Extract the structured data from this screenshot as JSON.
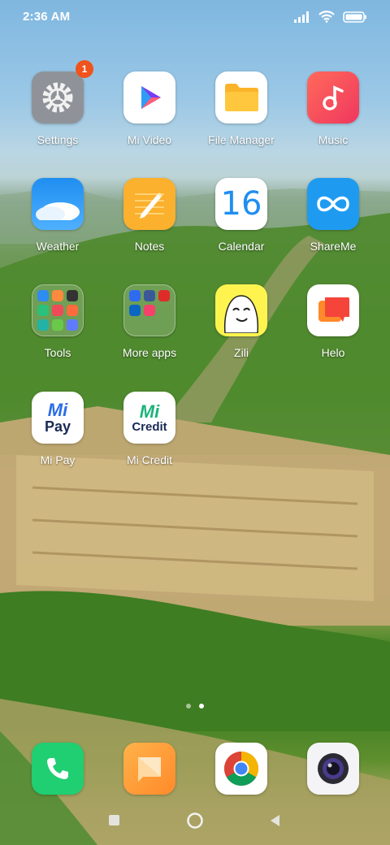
{
  "status_bar": {
    "time": "2:36 AM",
    "icons": [
      "signal-icon",
      "wifi-icon",
      "battery-icon"
    ]
  },
  "apps": {
    "settings": {
      "label": "Settings",
      "badge": "1"
    },
    "mi_video": {
      "label": "Mi Video"
    },
    "file_manager": {
      "label": "File Manager"
    },
    "music": {
      "label": "Music"
    },
    "weather": {
      "label": "Weather"
    },
    "notes": {
      "label": "Notes"
    },
    "calendar": {
      "label": "Calendar",
      "day": "16"
    },
    "shareme": {
      "label": "ShareMe"
    },
    "tools": {
      "label": "Tools"
    },
    "more_apps": {
      "label": "More apps"
    },
    "zili": {
      "label": "Zili"
    },
    "helo": {
      "label": "Helo"
    },
    "mi_pay": {
      "label": "Mi Pay",
      "logo_top": "Mi",
      "logo_bottom": "Pay"
    },
    "mi_credit": {
      "label": "Mi Credit",
      "logo_top": "Mi",
      "logo_bottom": "Credit"
    }
  },
  "dock": [
    "phone-icon",
    "messaging-icon",
    "chrome-icon",
    "camera-icon"
  ],
  "page_indicator": {
    "count": 2,
    "active": 2
  },
  "nav_bar": [
    "recents-icon",
    "home-icon",
    "back-icon"
  ],
  "colors": {
    "badge": "#f0531c",
    "accent_blue": "#1f8ef0",
    "file_manager_yellow": "#fbb42a",
    "music_red": "#f04a5a"
  }
}
